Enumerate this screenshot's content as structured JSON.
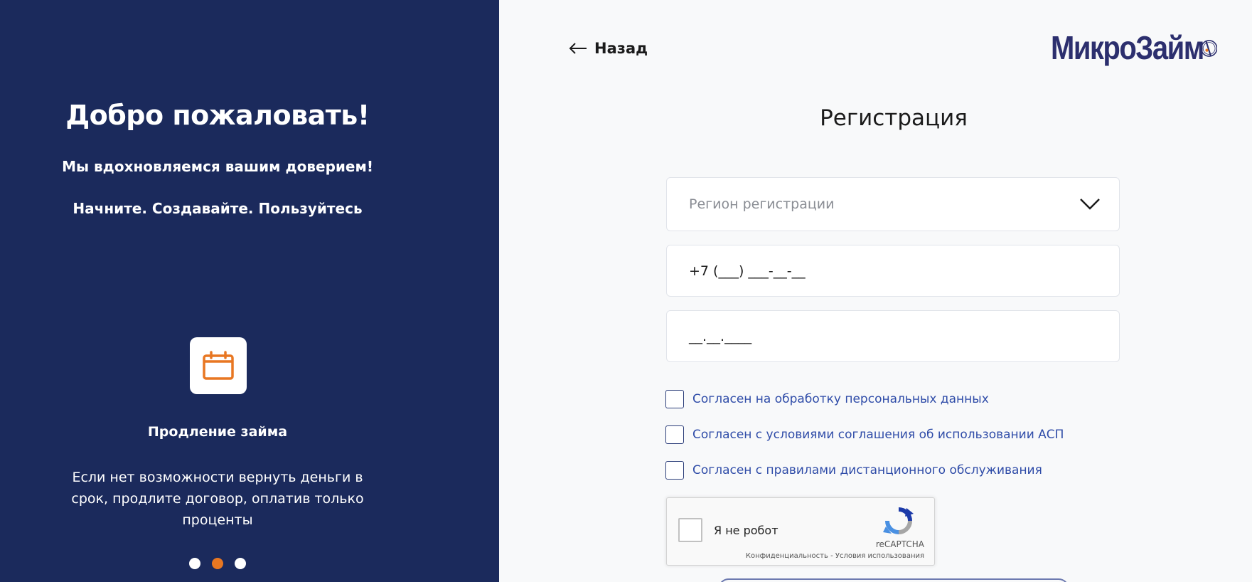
{
  "left": {
    "title": "Добро пожаловать!",
    "subtitle1": "Мы вдохновляемся вашим доверием!",
    "subtitle2": "Начните. Создавайте. Пользуйтесь",
    "feature": {
      "icon": "calendar-icon",
      "title": "Продление займа",
      "text": "Если нет возможности вернуть деньги в срок, продлите договор, оплатив только проценты"
    },
    "slides": 3,
    "active_slide": 2,
    "colors": {
      "background": "#1b2a5c",
      "accent": "#e87722"
    }
  },
  "header": {
    "back_label": "Назад",
    "logo_text": "МикроЗайм"
  },
  "form": {
    "title": "Регистрация",
    "region_placeholder": "Регион регистрации",
    "phone_value": "+7 (___) ___-__-__",
    "date_value": "__.__.____",
    "consents": [
      {
        "label": "Согласен на обработку персональных данных",
        "checked": false
      },
      {
        "label": "Согласен с условиями соглашения об использовании АСП",
        "checked": false
      },
      {
        "label": "Согласен с правилами дистанционного обслуживания",
        "checked": false
      }
    ],
    "captcha": {
      "label": "Я не робот",
      "brand": "reCAPTCHA",
      "links": "Конфиденциальность - Условия использования"
    }
  }
}
